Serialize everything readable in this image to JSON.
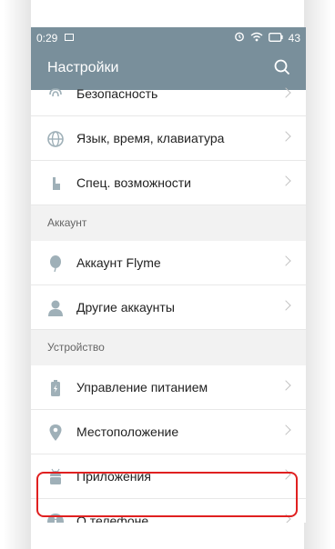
{
  "statusbar": {
    "time": "0:29",
    "battery": "43"
  },
  "appbar": {
    "title": "Настройки"
  },
  "rows_top": [
    {
      "label": "Безопасность",
      "icon": "fingerprint-icon"
    },
    {
      "label": "Язык, время, клавиатура",
      "icon": "globe-icon"
    },
    {
      "label": "Спец. возможности",
      "icon": "hand-icon"
    }
  ],
  "section_account": "Аккаунт",
  "rows_account": [
    {
      "label": "Аккаунт Flyme",
      "icon": "balloon-icon"
    },
    {
      "label": "Другие аккаунты",
      "icon": "person-icon"
    }
  ],
  "section_device": "Устройство",
  "rows_device": [
    {
      "label": "Управление питанием",
      "icon": "battery-icon"
    },
    {
      "label": "Местоположение",
      "icon": "location-pin-icon"
    },
    {
      "label": "Приложения",
      "icon": "android-icon"
    },
    {
      "label": "О телефоне",
      "icon": "info-icon"
    }
  ],
  "colors": {
    "appbar": "#798f9b",
    "icon": "#9fb0b8",
    "highlight": "#e02020"
  }
}
